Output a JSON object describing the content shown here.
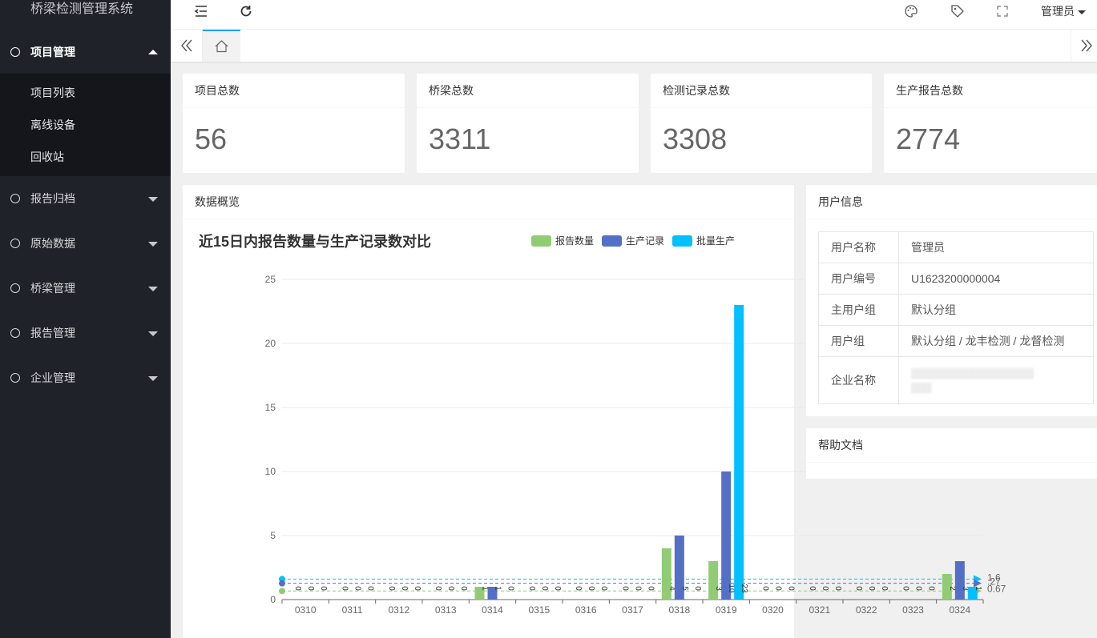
{
  "app": {
    "title": "桥梁检测管理系统",
    "user": "管理员"
  },
  "sidebar": {
    "open_menu": "项目管理",
    "sub_items": [
      "项目列表",
      "离线设备",
      "回收站"
    ],
    "menus": [
      "报告归档",
      "原始数据",
      "桥梁管理",
      "报告管理",
      "企业管理"
    ]
  },
  "stats": [
    {
      "label": "项目总数",
      "value": "56"
    },
    {
      "label": "桥梁总数",
      "value": "3311"
    },
    {
      "label": "检测记录总数",
      "value": "3308"
    },
    {
      "label": "生产报告总数",
      "value": "2774"
    }
  ],
  "overview": {
    "title": "数据概览"
  },
  "chart_data": {
    "type": "bar",
    "title": "近15日内报告数量与生产记录数对比",
    "categories": [
      "0310",
      "0311",
      "0312",
      "0313",
      "0314",
      "0315",
      "0316",
      "0317",
      "0318",
      "0319",
      "0320",
      "0321",
      "0322",
      "0323",
      "0324"
    ],
    "series": [
      {
        "name": "报告数量",
        "color": "#91cc75",
        "values": [
          0,
          0,
          0,
          0,
          1,
          0,
          0,
          0,
          4,
          3,
          0,
          0,
          0,
          0,
          2
        ],
        "avg": 0.67
      },
      {
        "name": "生产记录",
        "color": "#5470c6",
        "values": [
          0,
          0,
          0,
          0,
          1,
          0,
          0,
          0,
          5,
          10,
          0,
          0,
          0,
          0,
          3
        ],
        "avg": 1.27
      },
      {
        "name": "批量生产",
        "color": "#00c0ff",
        "values": [
          0,
          0,
          0,
          0,
          0,
          0,
          0,
          0,
          0,
          23,
          0,
          0,
          0,
          0,
          1
        ],
        "avg": 1.6
      }
    ],
    "ylim": [
      0,
      25
    ],
    "yticks": [
      0,
      5,
      10,
      15,
      20,
      25
    ],
    "avg_labels": [
      "1.6",
      ".27",
      "0.67"
    ],
    "legend": "top-right"
  },
  "user_info": {
    "title": "用户信息",
    "rows": [
      {
        "k": "用户名称",
        "v": "管理员"
      },
      {
        "k": "用户编号",
        "v": "U1623200000004"
      },
      {
        "k": "主用户组",
        "v": "默认分组"
      },
      {
        "k": "用户组",
        "v": "默认分组 / 龙丰检测 / 龙督检测"
      },
      {
        "k": "企业名称",
        "v": ""
      }
    ]
  },
  "help": {
    "title": "帮助文档"
  }
}
